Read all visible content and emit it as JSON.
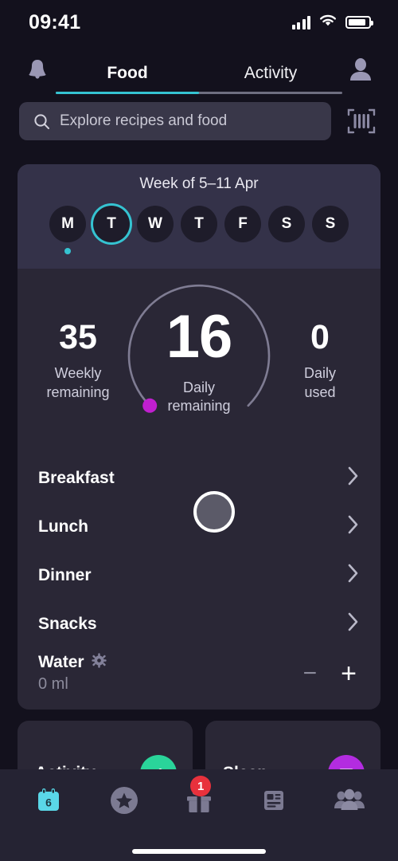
{
  "status_bar": {
    "time": "09:41",
    "signal_icon": "cellular-signal-icon",
    "wifi_icon": "wifi-icon",
    "battery_icon": "battery-icon"
  },
  "header": {
    "notifications_icon": "bell-icon",
    "profile_icon": "profile-avatar-icon",
    "tabs": [
      {
        "label": "Food",
        "active": true
      },
      {
        "label": "Activity",
        "active": false
      }
    ]
  },
  "search": {
    "placeholder": "Explore recipes and food",
    "value": "",
    "search_icon": "search-icon",
    "scan_icon": "barcode-scan-icon"
  },
  "week": {
    "title": "Week of 5–11 Apr",
    "days": [
      {
        "letter": "M",
        "selected": false,
        "has_dot": true
      },
      {
        "letter": "T",
        "selected": true,
        "has_dot": false
      },
      {
        "letter": "W",
        "selected": false,
        "has_dot": false
      },
      {
        "letter": "T",
        "selected": false,
        "has_dot": false
      },
      {
        "letter": "F",
        "selected": false,
        "has_dot": false
      },
      {
        "letter": "S",
        "selected": false,
        "has_dot": false
      },
      {
        "letter": "S",
        "selected": false,
        "has_dot": false
      }
    ]
  },
  "summary": {
    "weekly_remaining_value": "35",
    "weekly_remaining_label_1": "Weekly",
    "weekly_remaining_label_2": "remaining",
    "daily_remaining_value": "16",
    "daily_remaining_label_1": "Daily",
    "daily_remaining_label_2": "remaining",
    "daily_used_value": "0",
    "daily_used_label_1": "Daily",
    "daily_used_label_2": "used",
    "ring_track_color": "#8e8ca3",
    "ring_marker_color": "#c01fcf"
  },
  "meals": [
    {
      "name": "Breakfast",
      "chevron_icon": "chevron-right-icon"
    },
    {
      "name": "Lunch",
      "chevron_icon": "chevron-right-icon"
    },
    {
      "name": "Dinner",
      "chevron_icon": "chevron-right-icon"
    },
    {
      "name": "Snacks",
      "chevron_icon": "chevron-right-icon"
    }
  ],
  "water": {
    "title": "Water",
    "settings_icon": "gear-icon",
    "amount": "0 ml",
    "minus_label": "−",
    "plus_label": "+"
  },
  "bottom_cards": [
    {
      "title": "Activity",
      "icon": "running-shoe-icon",
      "icon_color": "#2ad49a"
    },
    {
      "title": "Sleep",
      "icon": "bed-icon",
      "icon_color": "#b32ce0"
    }
  ],
  "bottom_nav": [
    {
      "icon": "calendar-icon",
      "badge": null,
      "day_number": "6",
      "active": true
    },
    {
      "icon": "star-circle-icon",
      "badge": null,
      "active": false
    },
    {
      "icon": "gift-icon",
      "badge": "1",
      "active": false
    },
    {
      "icon": "news-icon",
      "badge": null,
      "active": false
    },
    {
      "icon": "community-icon",
      "badge": null,
      "active": false
    }
  ],
  "colors": {
    "page_bg": "#13111d",
    "card_bg": "#2a2736",
    "card_header_bg": "#343249",
    "accent_cyan": "#35c3d1",
    "accent_magenta": "#c01fcf",
    "badge_red": "#e8313c"
  }
}
